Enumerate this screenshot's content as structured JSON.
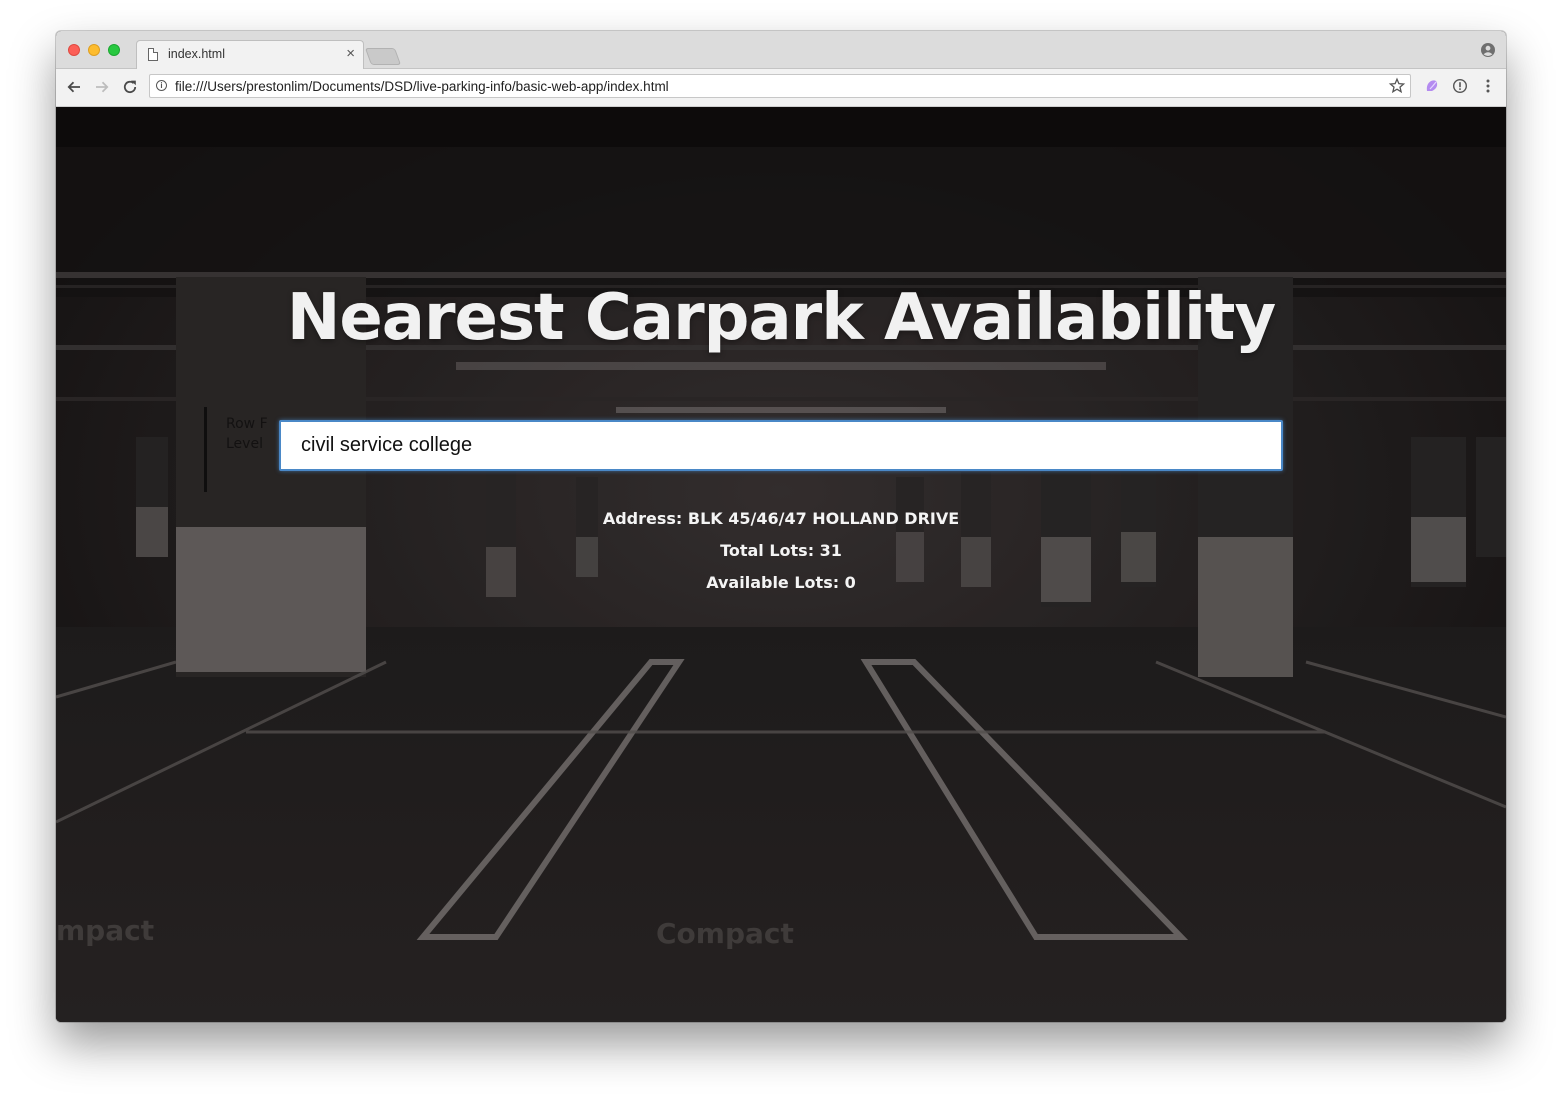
{
  "browser": {
    "tab": {
      "title": "index.html",
      "icon": "document-icon",
      "close": "×"
    },
    "url": "file:///Users/prestonlim/Documents/DSD/live-parking-info/basic-web-app/index.html"
  },
  "page": {
    "title": "Nearest Carpark Availability",
    "search": {
      "value": "civil service college"
    },
    "results": {
      "address": "Address: BLK 45/46/47 HOLLAND DRIVE",
      "total_lots": "Total Lots: 31",
      "available_lots": "Available Lots: 0"
    },
    "background_markings": {
      "row_label": "Row F",
      "level_label": "Level",
      "floor_text_left": "mpact",
      "floor_text_center": "Compact"
    }
  },
  "colors": {
    "input_focus": "#4a88c7",
    "title_text": "#f1f1f1",
    "results_text": "#f4f4f4"
  }
}
